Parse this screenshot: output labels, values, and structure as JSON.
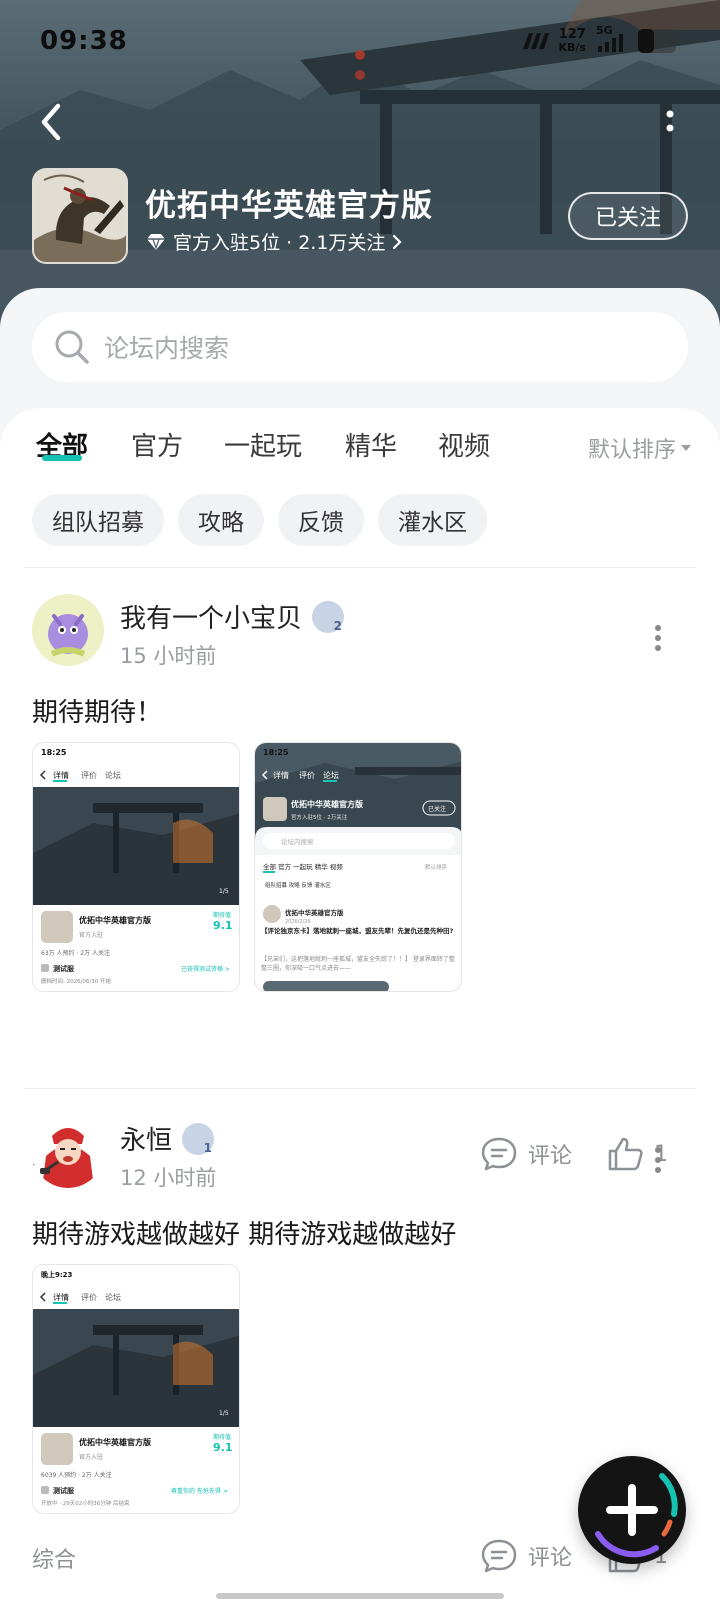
{
  "status_bar": {
    "time": "09:38",
    "net_speed_value": "127",
    "net_speed_unit": "KB/s",
    "network": "5G"
  },
  "header": {
    "app_title": "优拓中华英雄官方版",
    "meta": "官方入驻5位 · 2.1万关注",
    "follow_label": "已关注"
  },
  "search": {
    "placeholder": "论坛内搜索"
  },
  "tabs": [
    {
      "label": "全部",
      "active": true
    },
    {
      "label": "官方",
      "active": false
    },
    {
      "label": "一起玩",
      "active": false
    },
    {
      "label": "精华",
      "active": false
    },
    {
      "label": "视频",
      "active": false
    }
  ],
  "sort_label": "默认排序",
  "chips": [
    "组队招募",
    "攻略",
    "反馈",
    "灌水区"
  ],
  "posts": [
    {
      "author": "我有一个小宝贝",
      "level": "2",
      "time": "15 小时前",
      "text": "期待期待！",
      "category": "综合",
      "comment_label": "评论",
      "like_count": "1"
    },
    {
      "author": "永恒",
      "level": "1",
      "time": "12 小时前",
      "text": "期待游戏越做越好  期待游戏越做越好",
      "category": "综合",
      "comment_label": "评论",
      "like_count": "1"
    }
  ],
  "thumb_a": {
    "time": "18:25",
    "tab1": "详情",
    "tab2": "评价",
    "tab3": "论坛",
    "title": "优拓中华英雄官方版",
    "score_label": "期待值",
    "score": "9.1",
    "sub": "官方入驻",
    "stats": "63万 人预约 · 2万 人关注",
    "server": "测试服",
    "server_note": "删档时间: 2026/06/30 开始",
    "link": "已获得测试资格 >",
    "page": "1/5"
  },
  "thumb_b": {
    "time": "18:25",
    "tab1": "详情",
    "tab2": "评价",
    "tab3": "论坛",
    "title": "优拓中华英雄官方版",
    "meta": "官方入驻5位 · 2万关注",
    "follow": "已关注",
    "search": "论坛内搜索",
    "tabs": "全部  官方  一起玩  精华  视频",
    "sort": "默认排序",
    "chips": "组队招募  攻略  反馈  灌水区",
    "post_date": "2026/2/26",
    "post_title": "【评论独京东卡】落地就刺一座城，盟友先辈！先复仇还是先种田?",
    "post_body": "【兄弟们，这把落地就刺一座孤城，盟友全失踪了！！】 登录界面转了整整三圈，你深吸一口气点进去——"
  },
  "thumb_c": {
    "time": "晚上9:23",
    "tab1": "详情",
    "tab2": "评价",
    "tab3": "论坛",
    "title": "优拓中华英雄官方版",
    "score_label": "期待值",
    "score": "9.1",
    "sub": "官方入驻",
    "stats": "6039 人预约 · 2万 人关注",
    "server": "测试服",
    "server_note": "开放中 · 29天02小时36分钟 后结束",
    "link": "尊重你的 先抢先得 >",
    "page": "1/5"
  },
  "colors": {
    "accent": "#16c2b1",
    "hero_bg": "#3b4c57"
  }
}
